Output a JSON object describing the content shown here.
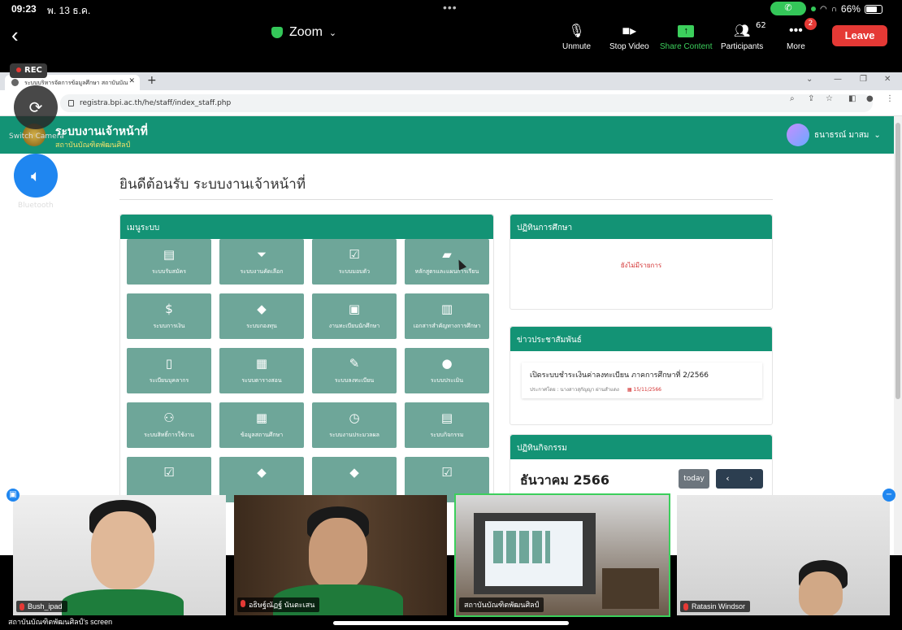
{
  "status": {
    "time": "09:23",
    "date": "พ. 13 ธ.ค.",
    "battery": "66%"
  },
  "zoom": {
    "title": "Zoom",
    "unmute": "Unmute",
    "stop_video": "Stop Video",
    "share_content": "Share Content",
    "participants": "Participants",
    "participants_count": "62",
    "more": "More",
    "more_badge": "2",
    "leave": "Leave",
    "rec": "REC",
    "switch_camera": "Switch Camera",
    "bluetooth": "Bluetooth",
    "screen_label": "สถาบันบัณฑิตพัฒนศิลป์'s screen"
  },
  "browser": {
    "tab_title": "ระบบบริหารจัดการข้อมูลศึกษา สถาบันบัณ",
    "url": "registra.bpi.ac.th/he/staff/index_staff.php"
  },
  "site": {
    "title": "ระบบงานเจ้าหน้าที่",
    "subtitle": "สถาบันบัณฑิตพัฒนศิลป์",
    "user": "ธนาธรณ์ มาสม",
    "welcome": "ยินดีต้อนรับ ระบบงานเจ้าหน้าที่",
    "menu_header": "เมนูระบบ",
    "menu": [
      {
        "label": "ระบบรับสมัคร",
        "icon": "clipboard-icon"
      },
      {
        "label": "ระบบงานคัดเลือก",
        "icon": "filter-icon"
      },
      {
        "label": "ระบบมอบตัว",
        "icon": "clipboard-check-icon"
      },
      {
        "label": "หลักสูตรและแผนการเรียน",
        "icon": "folder-icon"
      },
      {
        "label": "ระบบการเงิน",
        "icon": "dollar-icon"
      },
      {
        "label": "ระบบกองทุน",
        "icon": "graduation-cap-icon"
      },
      {
        "label": "งานทะเบียนนักศึกษา",
        "icon": "id-card-icon"
      },
      {
        "label": "เอกสารสำคัญทางการศึกษา",
        "icon": "book-icon"
      },
      {
        "label": "ระเบียนบุคลากร",
        "icon": "file-icon"
      },
      {
        "label": "ระบบตารางสอน",
        "icon": "calendar-icon"
      },
      {
        "label": "ระบบลงทะเบียน",
        "icon": "edit-icon"
      },
      {
        "label": "ระบบประเมิน",
        "icon": "comments-icon"
      },
      {
        "label": "ระบบสิทธิ์การใช้งาน",
        "icon": "users-icon"
      },
      {
        "label": "ข้อมูลสถานศึกษา",
        "icon": "school-icon"
      },
      {
        "label": "ระบบงานประมวลผล",
        "icon": "clock-icon"
      },
      {
        "label": "ระบบกิจกรรม",
        "icon": "file-text-icon"
      },
      {
        "label": "",
        "icon": "calendar-check-icon"
      },
      {
        "label": "",
        "icon": "graduation-cap-icon"
      },
      {
        "label": "",
        "icon": "graduation-cap-icon"
      },
      {
        "label": "",
        "icon": "clipboard-check-icon"
      }
    ],
    "academic_header": "ปฏิทินการศึกษา",
    "academic_empty": "ยังไม่มีรายการ",
    "news_header": "ข่าวประชาสัมพันธ์",
    "news_title": "เปิดระบบชำระเงินค่าลงทะเบียน ภาคการศึกษาที่ 2/2566",
    "news_by": "ประกาศโดย : นางสาวสุกัญญา ผ่านสำแดง",
    "news_date": "15/11/2566",
    "activity_header": "ปฏิทินกิจกรรม",
    "calendar_month": "ธันวาคม 2566",
    "today": "today",
    "prev": "‹",
    "next": "›"
  },
  "participants_list": [
    {
      "name": "Bush_ipad"
    },
    {
      "name": "อธิษฐ์ณัฏฐ์ นันตะเสน"
    },
    {
      "name": "สถาบันบัณฑิตพัฒนศิลป์"
    },
    {
      "name": "Ratasin Windsor"
    }
  ],
  "colors": {
    "brand": "#139375",
    "tile": "#6ea699",
    "leave": "#e53935",
    "accent": "#3ccf5c"
  }
}
